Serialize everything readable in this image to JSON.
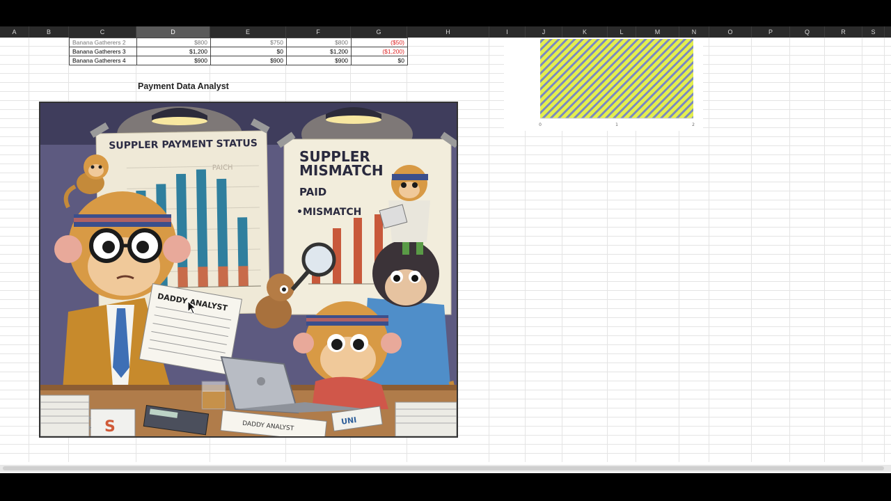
{
  "columns": [
    "A",
    "B",
    "C",
    "D",
    "E",
    "F",
    "G",
    "H",
    "I",
    "J",
    "K",
    "L",
    "M",
    "N",
    "O",
    "P",
    "Q",
    "R",
    "S"
  ],
  "selected_column": "D",
  "table": {
    "rows": [
      {
        "name": "Banana Gatherers 2",
        "d": "$800",
        "e": "$750",
        "f": "$800",
        "g": "($50)",
        "g_negative": true
      },
      {
        "name": "Banana Gatherers 3",
        "d": "$1,200",
        "e": "$0",
        "f": "$1,200",
        "g": "($1,200)",
        "g_negative": true
      },
      {
        "name": "Banana Gatherers 4",
        "d": "$900",
        "e": "$900",
        "f": "$900",
        "g": "$0",
        "g_negative": false
      }
    ]
  },
  "illustration": {
    "title": "Payment Data Analyst",
    "poster_left_title": "SUPPLER PAYMENT STATUS",
    "poster_left_sub": "PAICH",
    "poster_right_title_1": "SUPPLER",
    "poster_right_title_2": "MISMATCH",
    "poster_right_paid": "PAID",
    "poster_right_mismatch": "•MISMATCH",
    "paper_label": "DADDY ANALYST",
    "desk_paper_label": "DADDY ANALYST",
    "desk_paper_2": "UNI"
  },
  "mini_chart": {
    "x_ticks": [
      "0",
      "1",
      "2"
    ],
    "fill_colors": [
      "#e4ef4e",
      "#7a88c0"
    ]
  }
}
